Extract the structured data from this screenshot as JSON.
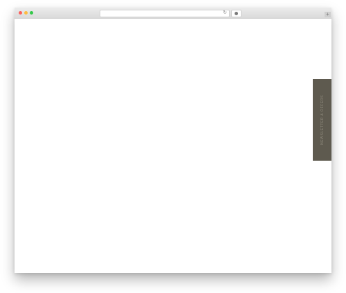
{
  "browser": {
    "controls": {
      "close_icon": "close-dot",
      "minimize_icon": "minimize-dot",
      "zoom_icon": "zoom-dot"
    },
    "address_bar": {
      "value": "",
      "reload_glyph": "↻"
    },
    "new_tab_glyph": "+"
  },
  "page": {
    "side_tab": {
      "label": "NEWSLETTER & OFFERS"
    }
  },
  "colors": {
    "side_tab_bg": "#5e5a4f",
    "side_tab_text": "#8e897c",
    "page_bg": "#ffffff"
  }
}
